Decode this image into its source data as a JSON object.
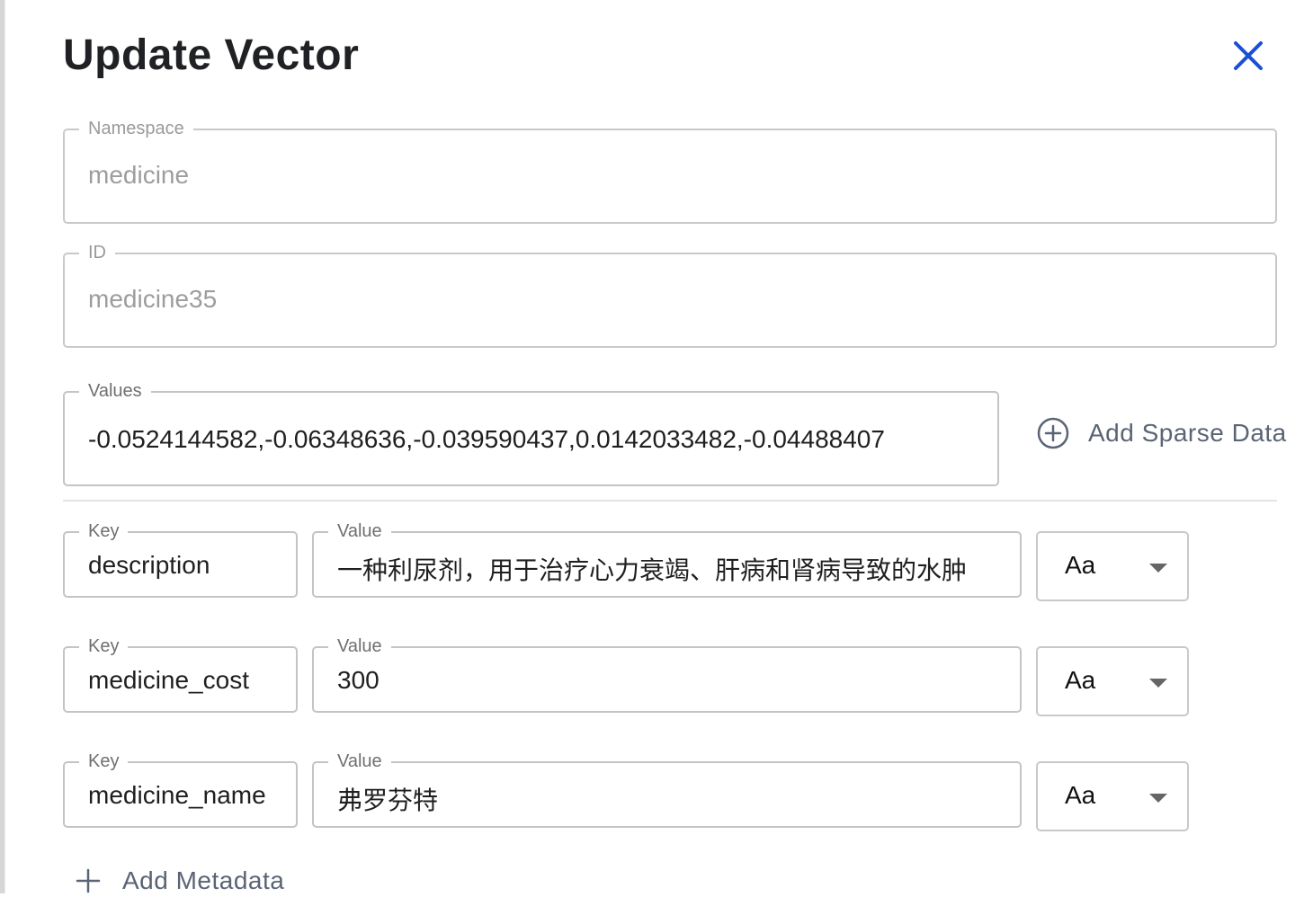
{
  "dialog": {
    "title": "Update Vector",
    "close_icon": "close-icon"
  },
  "fields": {
    "namespace": {
      "label": "Namespace",
      "value": "medicine"
    },
    "id": {
      "label": "ID",
      "value": "medicine35"
    },
    "values": {
      "label": "Values",
      "value": "-0.0524144582,-0.06348636,-0.039590437,0.0142033482,-0.04488407"
    }
  },
  "sparse": {
    "label": "Add Sparse Data",
    "icon": "plus-circle-icon"
  },
  "metadata": {
    "rows": [
      {
        "key_label": "Key",
        "key": "description",
        "value_label": "Value",
        "value": "一种利尿剂，用于治疗心力衰竭、肝病和肾病导致的水肿",
        "type": "Aa"
      },
      {
        "key_label": "Key",
        "key": "medicine_cost",
        "value_label": "Value",
        "value": "300",
        "type": "Aa"
      },
      {
        "key_label": "Key",
        "key": "medicine_name",
        "value_label": "Value",
        "value": "弗罗芬特",
        "type": "Aa"
      }
    ],
    "add_label": "Add Metadata",
    "add_icon": "plus-icon"
  },
  "colors": {
    "accent": "#1a4fd6",
    "muted_text": "#5b6475",
    "border": "#c9c9c9"
  }
}
